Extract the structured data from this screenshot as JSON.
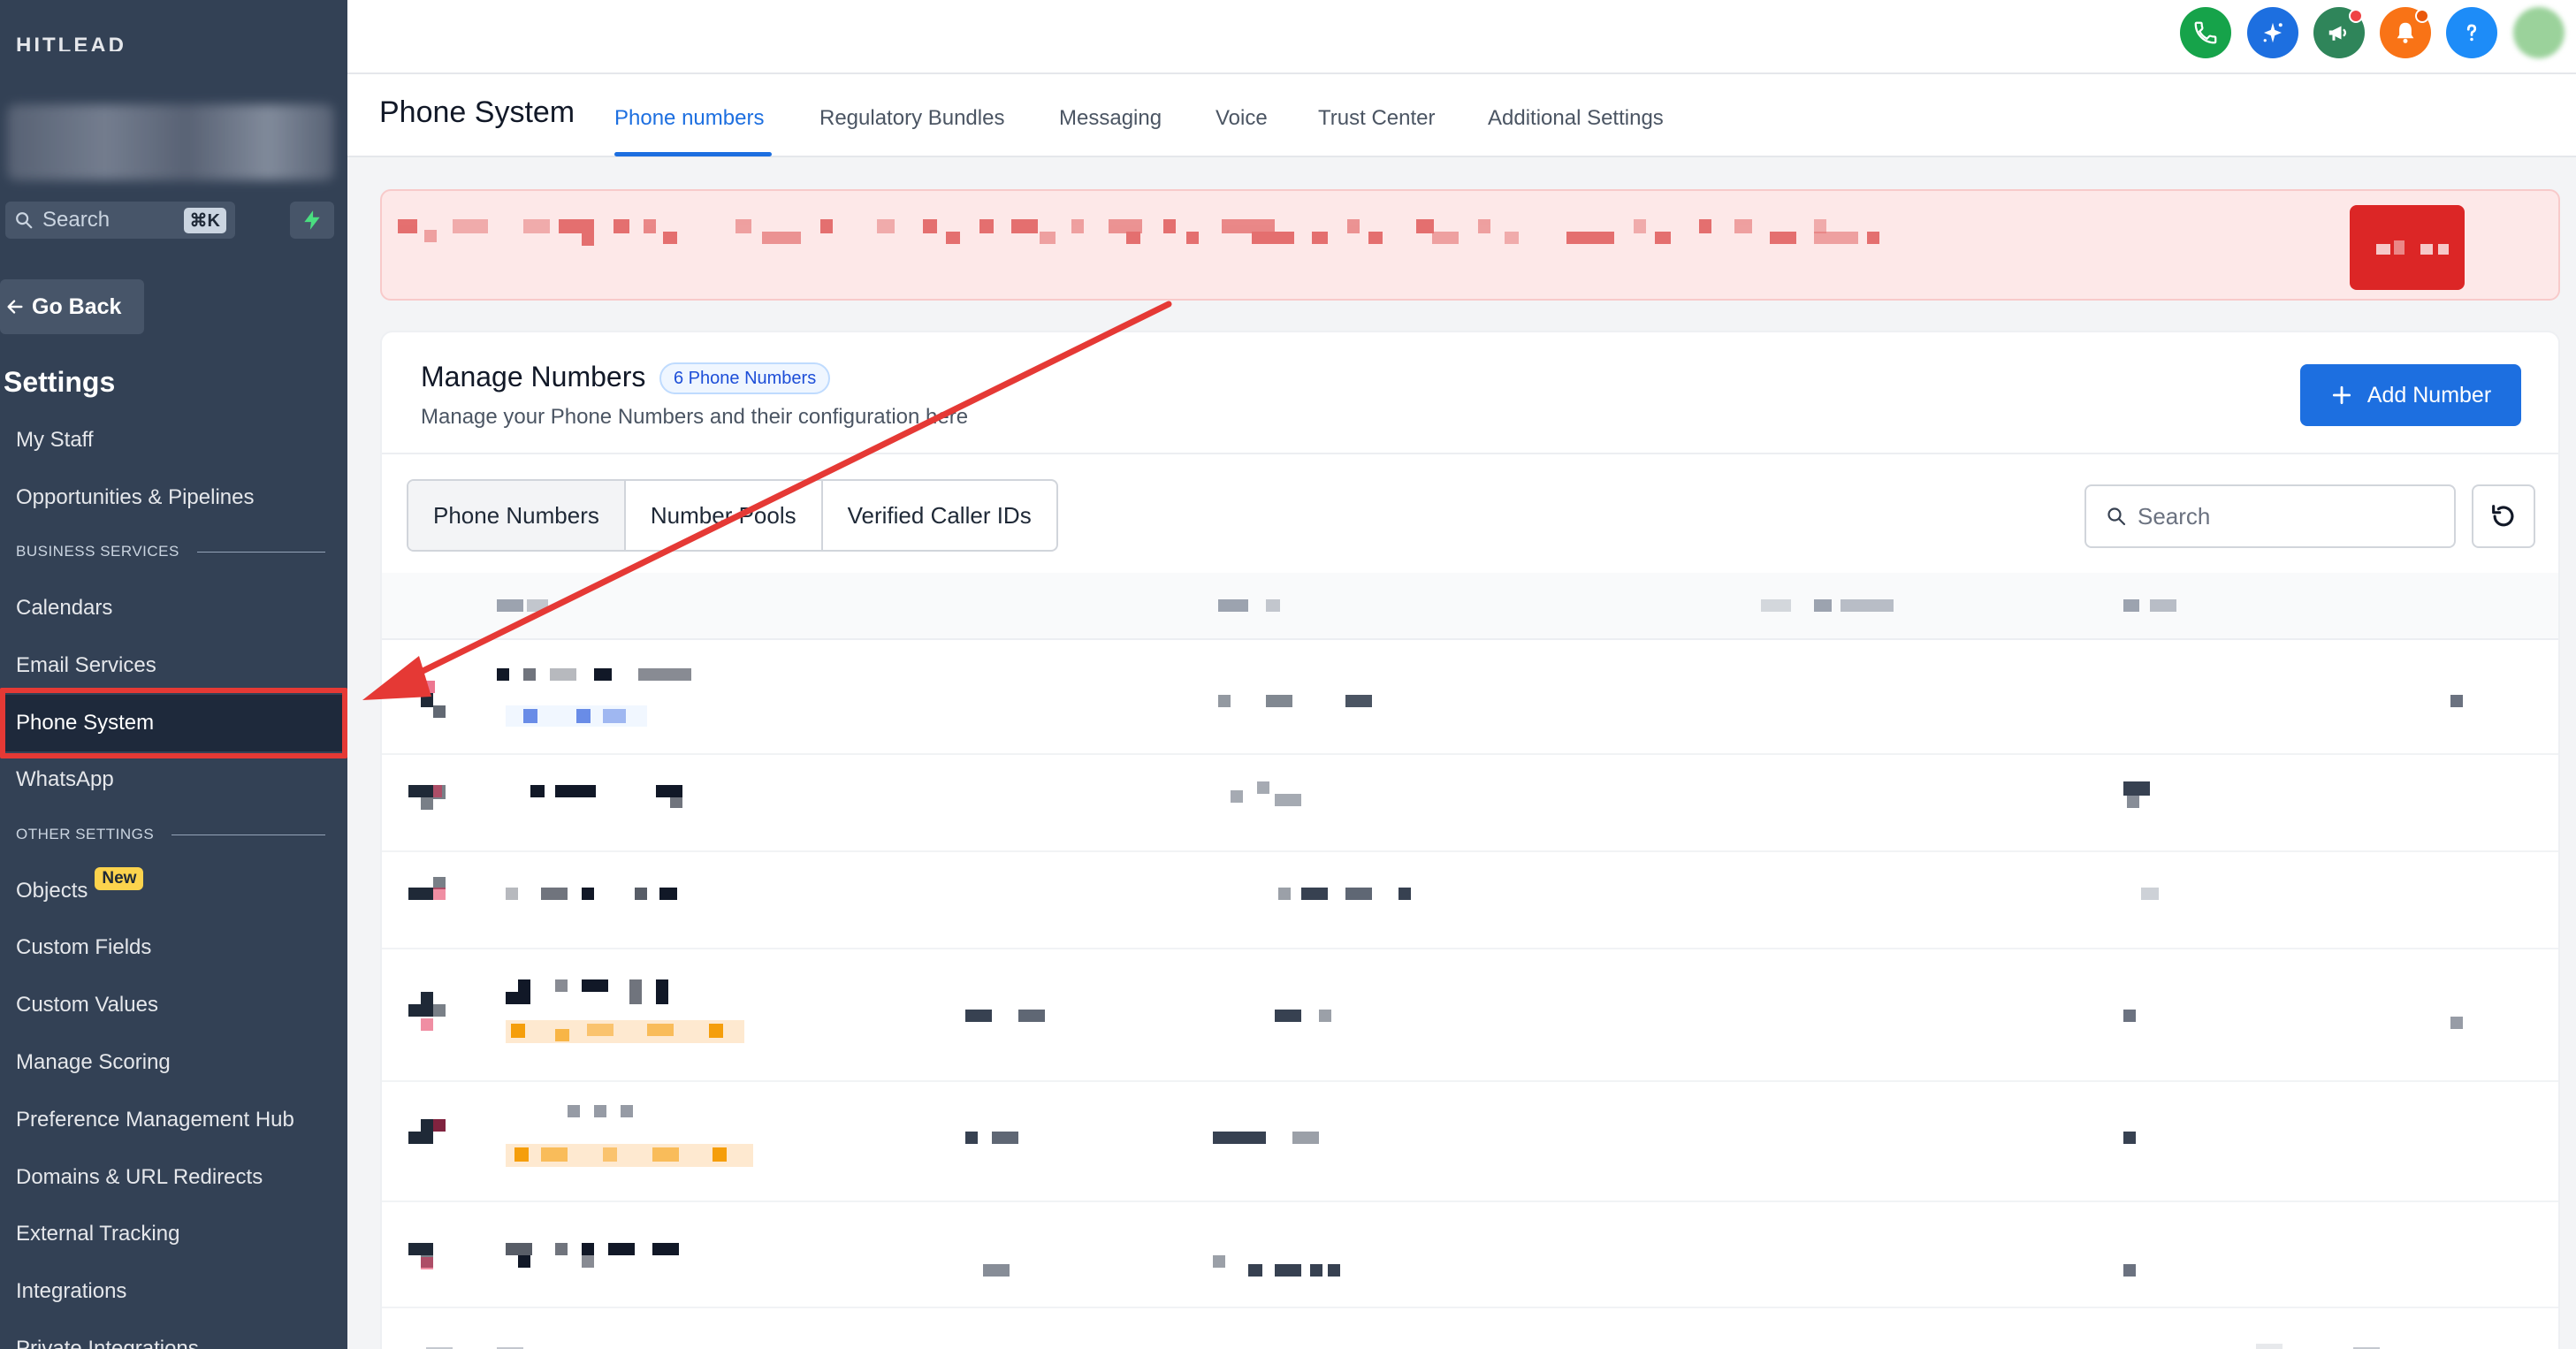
{
  "sidebar": {
    "brand": "HITLEAD",
    "search": {
      "placeholder": "Search",
      "shortcut": "⌘K"
    },
    "go_back": "Go Back",
    "section_title": "Settings",
    "items": [
      {
        "label": "My Staff"
      },
      {
        "label": "Opportunities & Pipelines"
      },
      {
        "label": "Calendars"
      },
      {
        "label": "Email Services"
      },
      {
        "label": "Phone System"
      },
      {
        "label": "WhatsApp"
      },
      {
        "label": "Objects",
        "badge": "New"
      },
      {
        "label": "Custom Fields"
      },
      {
        "label": "Custom Values"
      },
      {
        "label": "Manage Scoring"
      },
      {
        "label": "Preference Management Hub"
      },
      {
        "label": "Domains & URL Redirects"
      },
      {
        "label": "External Tracking"
      },
      {
        "label": "Integrations"
      },
      {
        "label": "Private Integrations"
      }
    ],
    "sections": {
      "business": "BUSINESS SERVICES",
      "other": "OTHER SETTINGS"
    }
  },
  "topbar": {
    "icons": [
      {
        "name": "phone-icon",
        "color": "#16a34a"
      },
      {
        "name": "sparkle-icon",
        "color": "#1d6fe0"
      },
      {
        "name": "megaphone-icon",
        "color": "#2f855a"
      },
      {
        "name": "bell-icon",
        "color": "#f97316"
      },
      {
        "name": "help-icon",
        "color": "#1d8cf8"
      }
    ]
  },
  "header": {
    "title": "Phone System",
    "tabs": [
      {
        "label": "Phone numbers",
        "active": true
      },
      {
        "label": "Regulatory Bundles"
      },
      {
        "label": "Messaging"
      },
      {
        "label": "Voice"
      },
      {
        "label": "Trust Center"
      },
      {
        "label": "Additional Settings"
      }
    ]
  },
  "card": {
    "title": "Manage Numbers",
    "count": "6 Phone Numbers",
    "subtitle": "Manage your Phone Numbers and their configuration here",
    "add_button": "Add Number",
    "segments": [
      "Phone Numbers",
      "Number Pools",
      "Verified Caller IDs"
    ],
    "search_placeholder": "Search"
  },
  "colors": {
    "accent": "#1d6fe0",
    "sidebar": "#334155",
    "highlight": "#e53935"
  }
}
